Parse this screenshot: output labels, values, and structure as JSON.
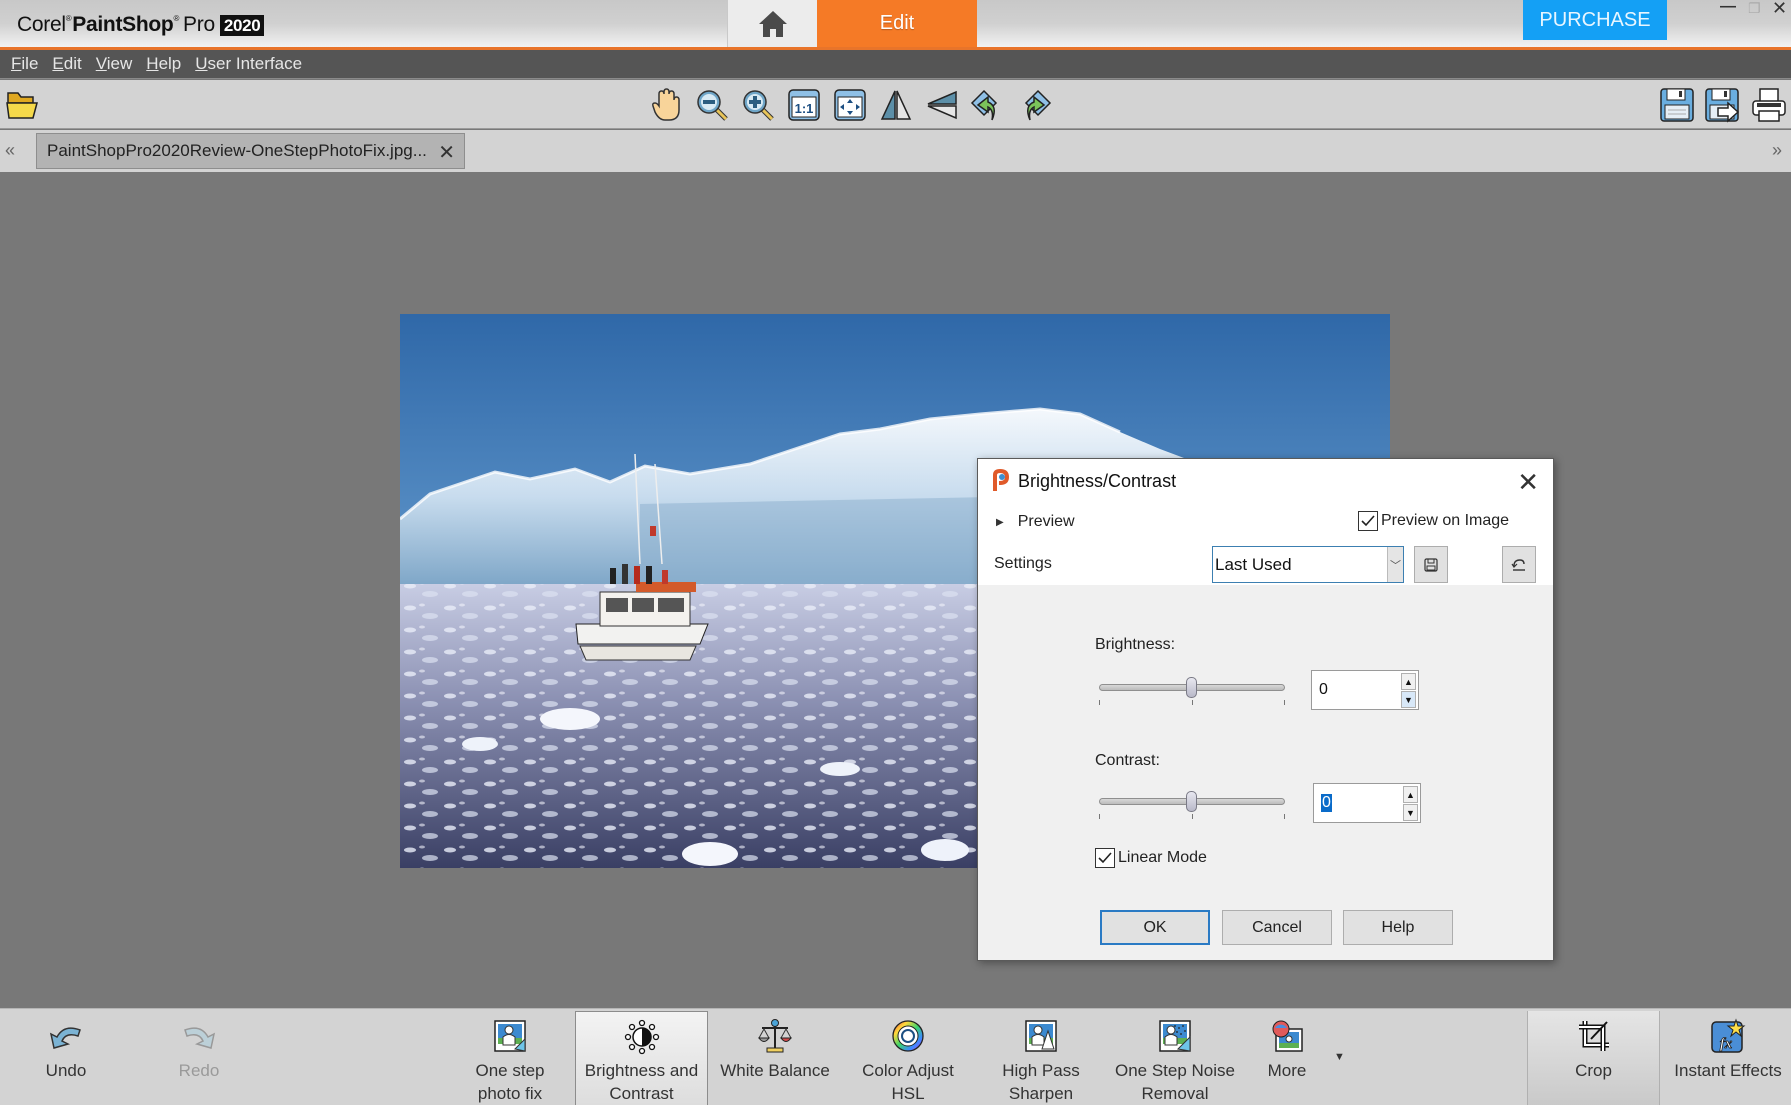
{
  "app": {
    "brand_corel": "Corel",
    "brand_paintshop": "PaintShop",
    "brand_pro": "Pro",
    "brand_year": "2020",
    "edit_tab": "Edit",
    "purchase": "PURCHASE"
  },
  "menu": [
    {
      "key": "F",
      "rest": "ile"
    },
    {
      "key": "E",
      "rest": "dit"
    },
    {
      "key": "V",
      "rest": "iew"
    },
    {
      "key": "H",
      "rest": "elp"
    },
    {
      "key": "U",
      "rest": "ser Interface"
    }
  ],
  "toolbar": {
    "left": [
      "open-folder-icon"
    ],
    "center": [
      "pan-hand-icon",
      "zoom-out-icon",
      "zoom-in-icon",
      "actual-size-icon",
      "fit-to-window-icon",
      "flip-vertical-icon",
      "mirror-horizontal-icon",
      "rotate-left-icon",
      "rotate-right-icon"
    ],
    "right": [
      "save-icon",
      "save-as-icon",
      "print-icon"
    ]
  },
  "document_tab": {
    "title": "PaintShopPro2020Review-OneStepPhotoFix.jpg..."
  },
  "dialog": {
    "title": "Brightness/Contrast",
    "preview_label": "Preview",
    "preview_on_image_label": "Preview on Image",
    "preview_on_image_checked": true,
    "settings_label": "Settings",
    "settings_value": "Last Used",
    "brightness_label": "Brightness:",
    "brightness_value": "0",
    "brightness_fraction": 0.5,
    "contrast_label": "Contrast:",
    "contrast_value": "0",
    "contrast_fraction": 0.5,
    "linear_mode_label": "Linear Mode",
    "linear_mode_checked": true,
    "ok": "OK",
    "cancel": "Cancel",
    "help": "Help"
  },
  "bottom_bar": {
    "undo": "Undo",
    "redo": "Redo",
    "one_step_1": "One step",
    "one_step_2": "photo fix",
    "brightness_1": "Brightness and",
    "brightness_2": "Contrast",
    "white_balance": "White Balance",
    "color_adjust_1": "Color Adjust",
    "color_adjust_2": "HSL",
    "high_pass_1": "High Pass",
    "high_pass_2": "Sharpen",
    "noise_1": "One Step Noise",
    "noise_2": "Removal",
    "more": "More",
    "crop": "Crop",
    "instant_effects": "Instant Effects"
  },
  "colors": {
    "accent_orange": "#f57a26",
    "purchase_blue": "#14a0f5",
    "canvas_gray": "#787878",
    "menubar": "#555555"
  }
}
